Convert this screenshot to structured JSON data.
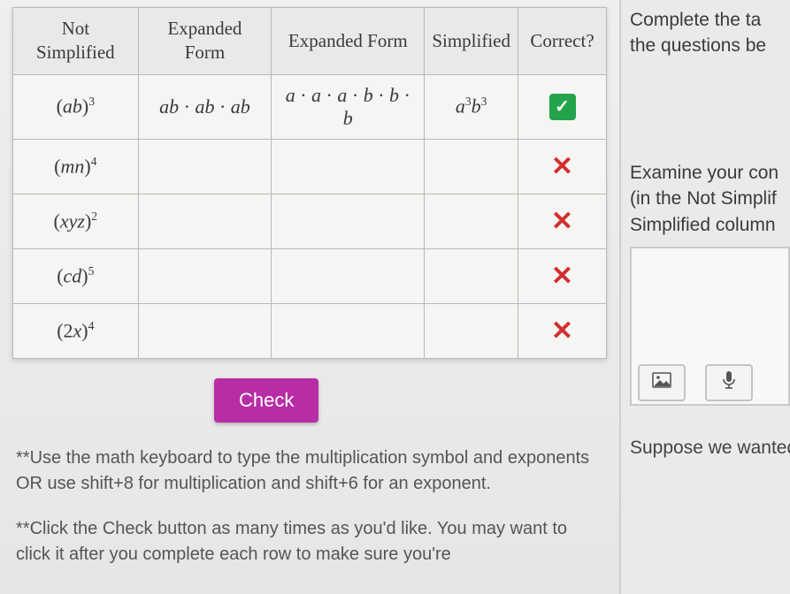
{
  "table": {
    "headers": {
      "c1": "Not Simplified",
      "c2": "Expanded Form",
      "c3": "Expanded Form",
      "c4": "Simplified",
      "c5": "Correct?"
    },
    "rows": [
      {
        "not_simplified": "(ab)³",
        "not_simplified_html": "(<span class='math'>ab</span>)<sup>3</sup>",
        "expanded1": "ab·ab·ab",
        "expanded1_html": "<span class='math'>ab</span> · <span class='math'>ab</span> · <span class='math'>ab</span>",
        "expanded2": "a·a·a·b·b·b",
        "expanded2_html": "<span class='math'>a</span> · <span class='math'>a</span> · <span class='math'>a</span> · <span class='math'>b</span> · <span class='math'>b</span> · <span class='math'>b</span>",
        "simplified": "a³b³",
        "simplified_html": "<span class='math'>a</span><sup>3</sup><span class='math'>b</span><sup>3</sup>",
        "correct": true
      },
      {
        "not_simplified": "(mn)⁴",
        "not_simplified_html": "(<span class='math'>mn</span>)<sup>4</sup>",
        "expanded1": "",
        "expanded2": "",
        "simplified": "",
        "correct": false
      },
      {
        "not_simplified": "(xyz)²",
        "not_simplified_html": "(<span class='math'>xyz</span>)<sup>2</sup>",
        "expanded1": "",
        "expanded2": "",
        "simplified": "",
        "correct": false
      },
      {
        "not_simplified": "(cd)⁵",
        "not_simplified_html": "(<span class='math'>cd</span>)<sup>5</sup>",
        "expanded1": "",
        "expanded2": "",
        "simplified": "",
        "correct": false
      },
      {
        "not_simplified": "(2x)⁴",
        "not_simplified_html": "(2<span class='math'>x</span>)<sup>4</sup>",
        "expanded1": "",
        "expanded2": "",
        "simplified": "",
        "correct": false
      }
    ]
  },
  "buttons": {
    "check": "Check"
  },
  "hints": {
    "h1": "**Use the math keyboard to type the multiplication symbol and exponents OR use shift+8 for multiplication and shift+6 for an exponent.",
    "h2": "**Click the Check button as many times as you'd like. You may want to click it after you complete each row to make sure you're"
  },
  "right": {
    "p1": "Complete the ta",
    "p1b": "the questions be",
    "p2a": "Examine your con",
    "p2b": "(in the Not Simplif",
    "p2c": "Simplified column",
    "p3": "Suppose we wanted to"
  },
  "icons": {
    "check": "✓",
    "x": "✕",
    "image": "▣",
    "mic": "↓"
  }
}
